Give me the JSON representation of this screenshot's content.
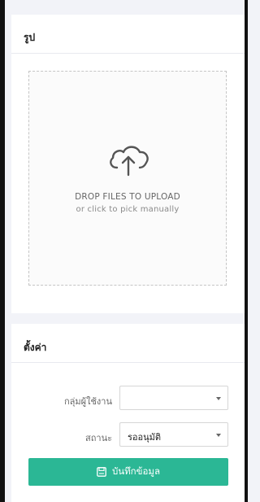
{
  "photo_card": {
    "title": "รูป",
    "dropzone": {
      "main_text": "DROP FILES TO UPLOAD",
      "sub_text": "or click to pick manually",
      "icon": "cloud-upload-icon"
    }
  },
  "settings_card": {
    "title": "ตั้งค่า",
    "fields": [
      {
        "label": "กลุ่มผู้ใช้งาน",
        "value": ""
      },
      {
        "label": "สถานะ",
        "value": "รออนุมัติ"
      }
    ],
    "save_button": {
      "label": "บันทึกข้อมูล",
      "icon": "save-icon"
    }
  },
  "colors": {
    "accent": "#2bb795",
    "background": "#f2f3f8"
  }
}
